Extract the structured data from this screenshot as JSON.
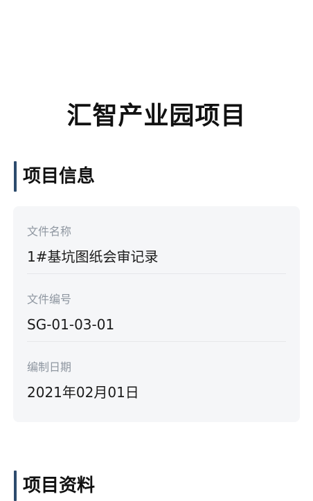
{
  "page": {
    "title": "汇智产业园项目"
  },
  "sections": {
    "info": {
      "title": "项目信息",
      "rows": [
        {
          "label": "文件名称",
          "value": "1#基坑图纸会审记录"
        },
        {
          "label": "文件编号",
          "value": "SG-01-03-01"
        },
        {
          "label": "编制日期",
          "value": "2021年02月01日"
        }
      ]
    },
    "files": {
      "title": "项目资料"
    }
  },
  "colors": {
    "accent": "#2d4b6d",
    "card_background": "#f5f6f8",
    "label_text": "#8e96a0"
  }
}
